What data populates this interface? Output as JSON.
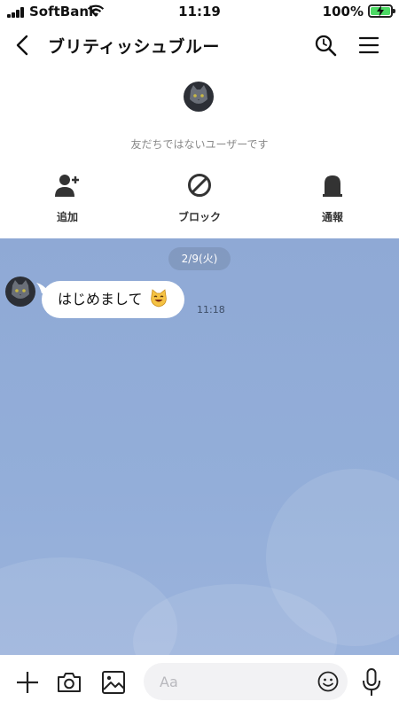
{
  "status_bar": {
    "carrier": "SoftBank",
    "time": "11:19",
    "battery_percent": "100%",
    "battery_color": "#4cd964"
  },
  "header": {
    "title": "ブリティッシュブルー",
    "icons": [
      "back-icon",
      "search-icon",
      "menu-icon"
    ]
  },
  "profile": {
    "not_friend_text": "友だちではないユーザーです",
    "actions": [
      {
        "label": "追加",
        "icon": "add-friend-icon"
      },
      {
        "label": "ブロック",
        "icon": "block-icon"
      },
      {
        "label": "通報",
        "icon": "report-icon"
      }
    ]
  },
  "chat": {
    "background_color": "#92acd8",
    "date": "2/9(火)",
    "messages": [
      {
        "text": "はじめまして",
        "emoji": "smiling-cat-icon",
        "time": "11:18"
      }
    ]
  },
  "input_bar": {
    "placeholder": "Aa",
    "icons": [
      "plus-icon",
      "camera-icon",
      "image-icon",
      "smile-icon",
      "mic-icon"
    ]
  }
}
